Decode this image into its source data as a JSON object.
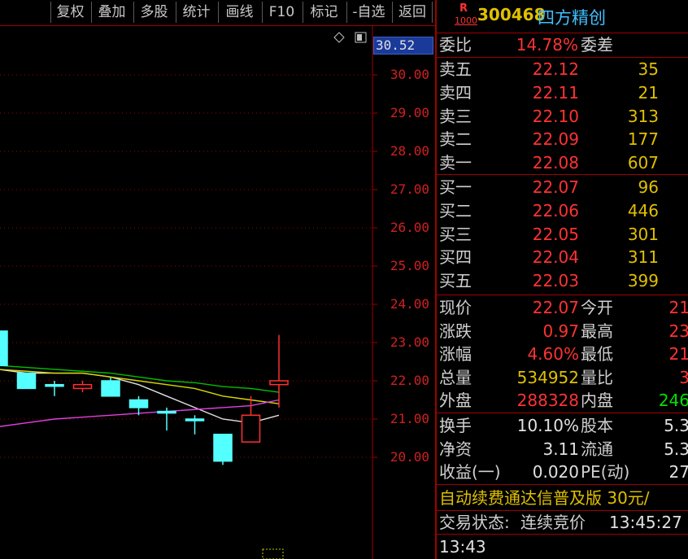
{
  "toolbar": {
    "buttons": [
      "复权",
      "叠加",
      "多股",
      "统计",
      "画线",
      "F10",
      "标记",
      "-自选",
      "返回"
    ]
  },
  "chart": {
    "current_price_tag": "30.52",
    "y_ticks": [
      "30.00",
      "29.00",
      "28.00",
      "27.00",
      "26.00",
      "25.00",
      "24.00",
      "23.00",
      "22.00",
      "21.00",
      "20.00"
    ],
    "y_range": [
      19.5,
      30.5
    ],
    "candles": [
      {
        "open": 23.3,
        "close": 22.4,
        "high": 23.3,
        "low": 22.2,
        "dir": "down"
      },
      {
        "open": 22.2,
        "close": 21.8,
        "high": 22.2,
        "low": 21.8,
        "dir": "down"
      },
      {
        "open": 21.9,
        "close": 21.9,
        "high": 22.0,
        "low": 21.6,
        "dir": "down"
      },
      {
        "open": 21.8,
        "close": 21.9,
        "high": 22.0,
        "low": 21.7,
        "dir": "up"
      },
      {
        "open": 22.0,
        "close": 21.6,
        "high": 22.1,
        "low": 21.6,
        "dir": "down"
      },
      {
        "open": 21.5,
        "close": 21.3,
        "high": 21.6,
        "low": 21.1,
        "dir": "down"
      },
      {
        "open": 21.2,
        "close": 21.2,
        "high": 21.3,
        "low": 20.7,
        "dir": "down"
      },
      {
        "open": 21.0,
        "close": 21.0,
        "high": 21.1,
        "low": 20.6,
        "dir": "down"
      },
      {
        "open": 20.6,
        "close": 19.9,
        "high": 20.6,
        "low": 19.8,
        "dir": "down"
      },
      {
        "open": 20.4,
        "close": 21.1,
        "high": 21.6,
        "low": 20.4,
        "dir": "up"
      },
      {
        "open": 21.9,
        "close": 22.0,
        "high": 23.2,
        "low": 21.3,
        "dir": "up"
      }
    ],
    "ma_colors": {
      "white": "#e0e0e0",
      "yellow": "#d8d800",
      "green": "#00c000",
      "magenta": "#e040e0"
    }
  },
  "stock": {
    "badge_top": "R",
    "badge_bottom": "1000",
    "code": "300468",
    "name": "四方精创"
  },
  "weibi": {
    "label": "委比",
    "value": "14.78%",
    "label2": "委差"
  },
  "asks": [
    {
      "label": "卖五",
      "price": "22.12",
      "vol": "35"
    },
    {
      "label": "卖四",
      "price": "22.11",
      "vol": "21"
    },
    {
      "label": "卖三",
      "price": "22.10",
      "vol": "313"
    },
    {
      "label": "卖二",
      "price": "22.09",
      "vol": "177"
    },
    {
      "label": "卖一",
      "price": "22.08",
      "vol": "607"
    }
  ],
  "bids": [
    {
      "label": "买一",
      "price": "22.07",
      "vol": "96"
    },
    {
      "label": "买二",
      "price": "22.06",
      "vol": "446"
    },
    {
      "label": "买三",
      "price": "22.05",
      "vol": "301"
    },
    {
      "label": "买四",
      "price": "22.04",
      "vol": "311"
    },
    {
      "label": "买五",
      "price": "22.03",
      "vol": "399"
    }
  ],
  "quote": [
    {
      "l": "现价",
      "v": "22.07",
      "vc": "red",
      "l2": "今开",
      "v2": "21",
      "v2c": "red"
    },
    {
      "l": "涨跌",
      "v": "0.97",
      "vc": "red",
      "l2": "最高",
      "v2": "23",
      "v2c": "red"
    },
    {
      "l": "涨幅",
      "v": "4.60%",
      "vc": "red",
      "l2": "最低",
      "v2": "21",
      "v2c": "red"
    },
    {
      "l": "总量",
      "v": "534952",
      "vc": "yel",
      "l2": "量比",
      "v2": "3",
      "v2c": "red"
    },
    {
      "l": "外盘",
      "v": "288328",
      "vc": "red",
      "l2": "内盘",
      "v2": "246",
      "v2c": "grn"
    }
  ],
  "fundamentals": [
    {
      "l": "换手",
      "v": "10.10%",
      "l2": "股本",
      "v2": "5.3"
    },
    {
      "l": "净资",
      "v": "3.11",
      "l2": "流通",
      "v2": "5.3"
    },
    {
      "l": "收益(一)",
      "v": "0.020",
      "l2": "PE(动)",
      "v2": "27"
    }
  ],
  "ad": "自动续费通达信普及版  30元/",
  "status": {
    "label": "交易状态:",
    "value": "连续竞价",
    "time": "13:45:27"
  },
  "tick_time": "13:43"
}
